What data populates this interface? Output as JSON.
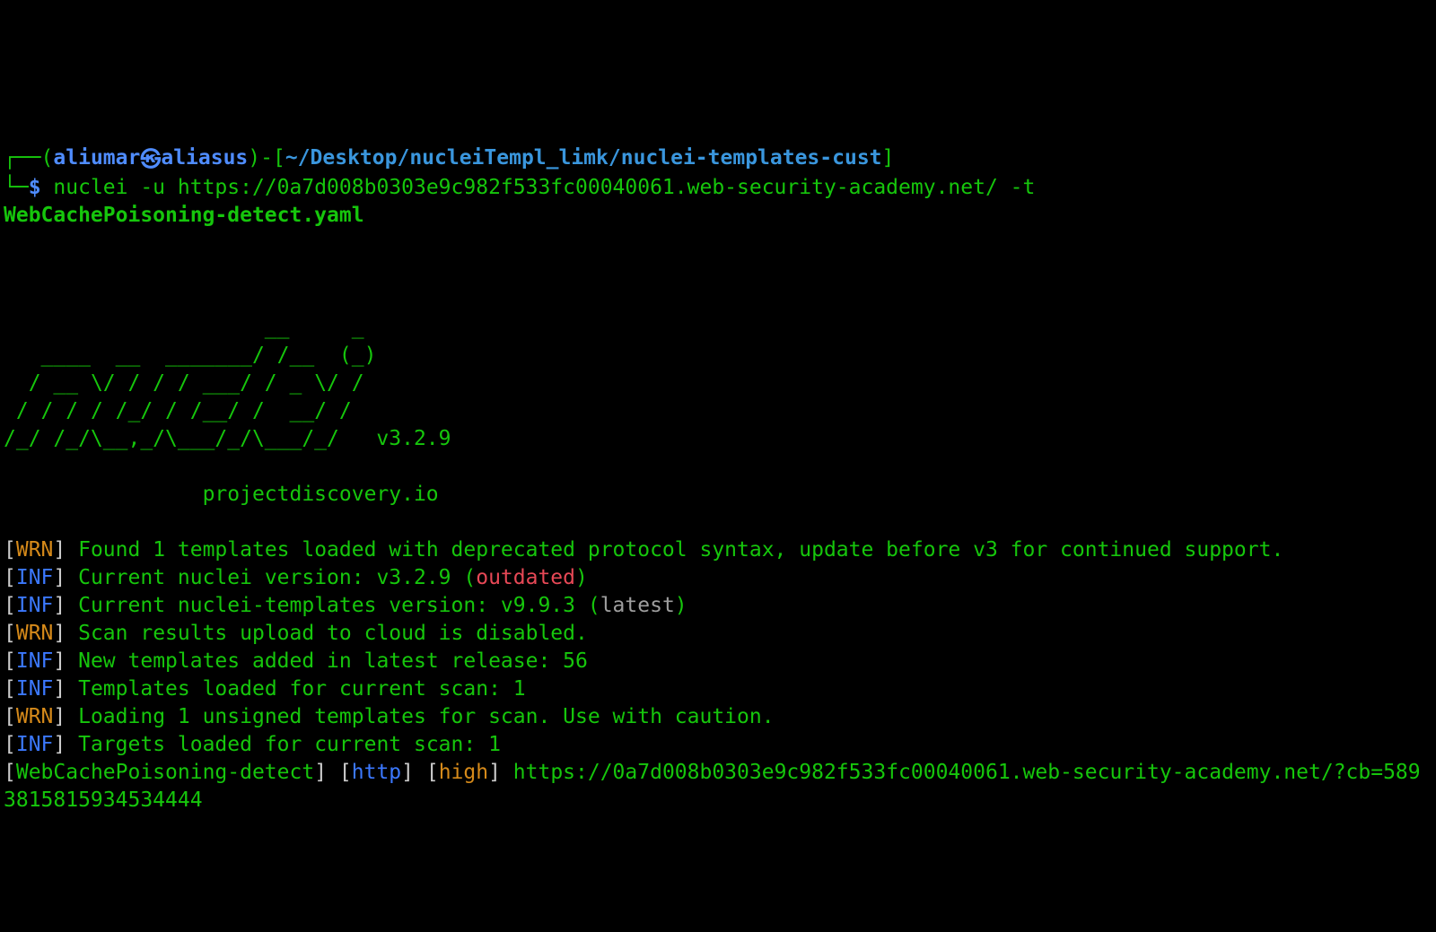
{
  "prompt": {
    "box_tl": "┌──",
    "lp": "(",
    "user": "aliumar",
    "host": "aliasus",
    "rp": ")",
    "sep_l": "-[",
    "cwd": "~/Desktop/nucleiTempl_limk/nuclei-templates-cust",
    "sep_r": "]",
    "box_bl": "└─",
    "dollar": "$ ",
    "cmd_prefix": "nuclei -u ",
    "cmd_url": "https://0a7d008b0303e9c982f533fc00040061.web-security-academy.net/",
    "cmd_flag": " -t ",
    "cmd_file": "WebCachePoisoning-detect.yaml"
  },
  "banner": {
    "l1": "                     __     _",
    "l2": "   ____  __  _______/ /__  (_)",
    "l3": "  / __ \\/ / / / ___/ / _ \\/ /",
    "l4": " / / / / /_/ / /__/ /  __/ /",
    "l5": "/_/ /_/\\__,_/\\___/_/\\___/_/   ",
    "version": "v3.2.9",
    "site": "\t\tprojectdiscovery.io"
  },
  "tag": {
    "lb": "[",
    "rb": "] ",
    "wrn": "WRN",
    "inf": "INF"
  },
  "msg": {
    "wrn1": "Found 1 templates loaded with deprecated protocol syntax, update before v3 for continued support.",
    "inf1a": "Current nuclei version: v3.2.9 (",
    "inf1b": "outdated",
    "inf1c": ")",
    "inf2a": "Current nuclei-templates version: v9.9.3 (",
    "inf2b": "latest",
    "inf2c": ")",
    "wrn2": "Scan results upload to cloud is disabled.",
    "inf3": "New templates added in latest release: 56",
    "inf4": "Templates loaded for current scan: 1",
    "wrn3": "Loading 1 unsigned templates for scan. Use with caution.",
    "inf5": "Targets loaded for current scan: 1"
  },
  "result": {
    "lb": "[",
    "name": "WebCachePoisoning-detect",
    "sep": "] [",
    "proto": "http",
    "sev": "high",
    "rb": "] ",
    "url": "https://0a7d008b0303e9c982f533fc00040061.web-security-academy.net/?cb=5893815815934534444"
  }
}
